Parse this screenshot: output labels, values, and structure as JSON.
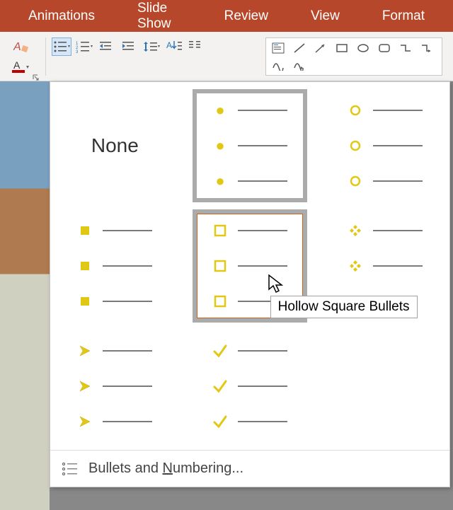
{
  "ribbon": {
    "tabs": [
      "Animations",
      "Slide Show",
      "Review",
      "View",
      "Format"
    ]
  },
  "bullets_menu": {
    "none_label": "None",
    "tooltip": "Hollow Square Bullets",
    "footer_label_pre": "Bullets and ",
    "footer_label_u": "N",
    "footer_label_post": "umbering...",
    "tiles": [
      {
        "id": "none"
      },
      {
        "id": "filled-round",
        "selected": true
      },
      {
        "id": "hollow-round"
      },
      {
        "id": "filled-square"
      },
      {
        "id": "hollow-square",
        "hovered": true
      },
      {
        "id": "four-diamond"
      },
      {
        "id": "arrow"
      },
      {
        "id": "check"
      }
    ]
  },
  "colors": {
    "accent": "#b7472a",
    "bullet": "#e0c814"
  }
}
